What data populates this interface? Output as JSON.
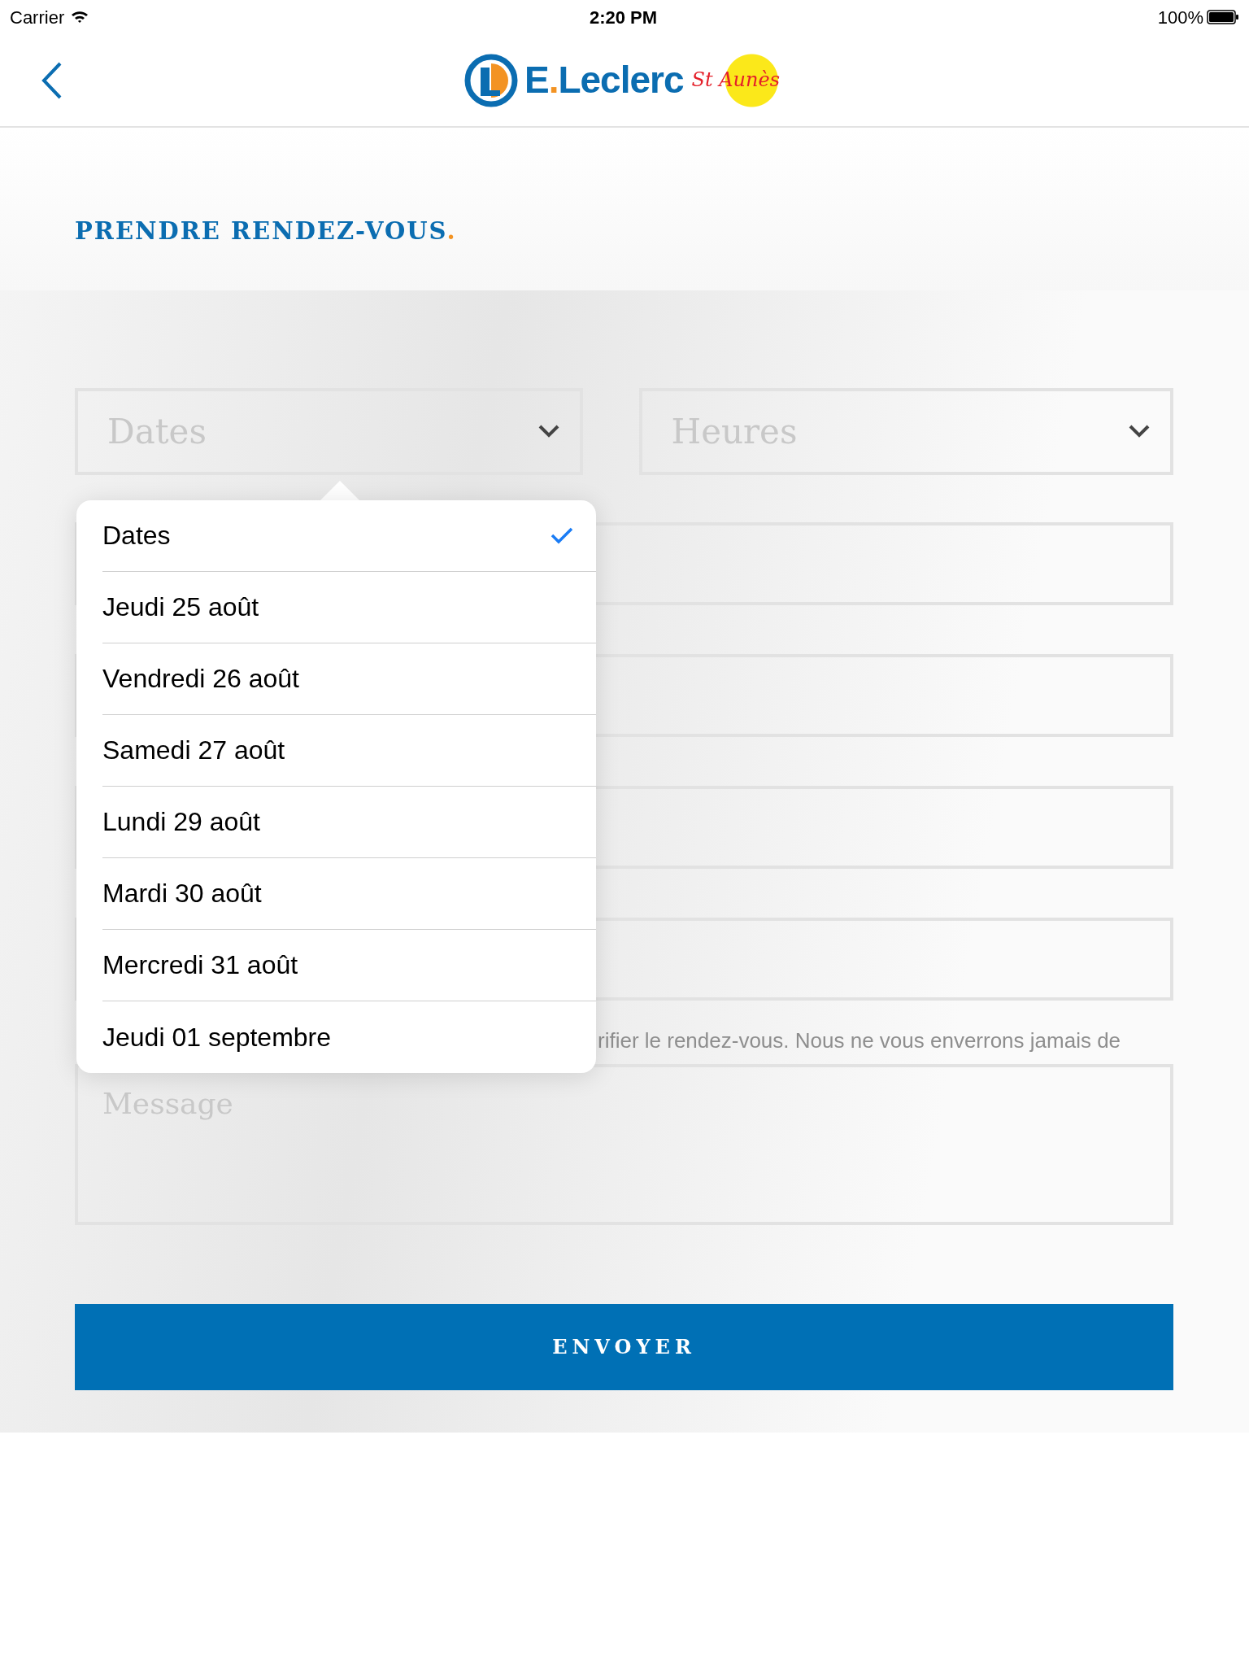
{
  "status_bar": {
    "carrier": "Carrier",
    "time": "2:20 PM",
    "battery": "100%"
  },
  "nav": {
    "brand": "E.Leclerc",
    "brand_script": "St Aunès"
  },
  "title": "PRENDRE RENDEZ-VOUS",
  "title_dot": ".",
  "selects": [
    {
      "placeholder": "Dates"
    },
    {
      "placeholder": "Heures"
    }
  ],
  "fields": [
    {
      "kind": "input"
    },
    {
      "kind": "input"
    },
    {
      "kind": "input"
    },
    {
      "kind": "input"
    }
  ],
  "hint": "rifier le rendez-vous. Nous ne vous enverrons jamais de",
  "message": {
    "placeholder": "Message"
  },
  "submit": "ENVOYER",
  "dropdown": [
    {
      "label": "Dates",
      "selected": true
    },
    {
      "label": "Jeudi 25 août",
      "selected": false
    },
    {
      "label": "Vendredi 26 août",
      "selected": false
    },
    {
      "label": "Samedi 27 août",
      "selected": false
    },
    {
      "label": "Lundi 29 août",
      "selected": false
    },
    {
      "label": "Mardi 30 août",
      "selected": false
    },
    {
      "label": "Mercredi 31 août",
      "selected": false
    },
    {
      "label": "Jeudi 01 septembre",
      "selected": false
    }
  ]
}
